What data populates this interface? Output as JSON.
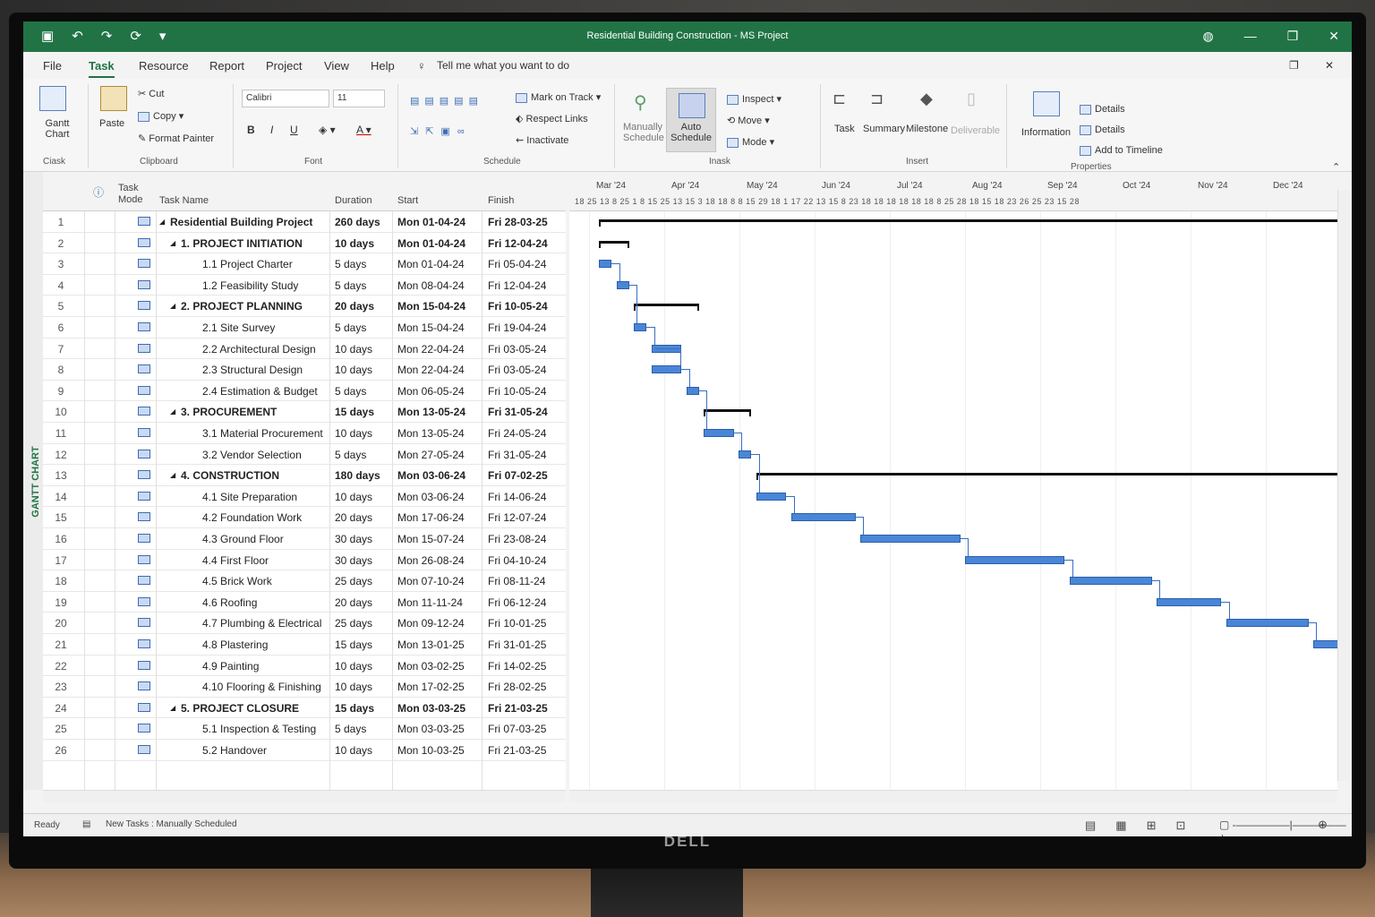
{
  "window": {
    "title": "Residential Building Construction  -  MS Project"
  },
  "menu": [
    "File",
    "Task",
    "Resource",
    "Report",
    "Project",
    "View",
    "Help"
  ],
  "menu_active": "Task",
  "tell_me": "Tell me what you want to do",
  "ribbon": {
    "gantt_chart": "Gantt Chart",
    "paste": "Paste",
    "cut": "Cut",
    "copy": "Copy",
    "format_painter": "Format Painter",
    "font_name": "Calibri",
    "font_size": "11",
    "mark_on_track": "Mark on Track",
    "respect_links": "Respect Links",
    "inactivate": "Inactivate",
    "manually_schedule": "Manually Schedule",
    "auto_schedule": "Auto Schedule",
    "inspect": "Inspect",
    "move": "Move",
    "mode": "Mode",
    "task": "Task",
    "summary": "Summary",
    "milestone": "Milestone",
    "deliverable": "Deliverable",
    "information": "Information",
    "details1": "Details",
    "details2": "Details",
    "add_to_timeline": "Add to Timeline",
    "groups": {
      "view": "Ciask",
      "clipboard": "Clipboard",
      "font": "Font",
      "schedule": "Schedule",
      "tasks": "Inask",
      "insert": "Insert",
      "properties": "Properties"
    }
  },
  "side_label": "GANTT CHART",
  "columns": {
    "mode": "Task Mode",
    "name": "Task Name",
    "duration": "Duration",
    "start": "Start",
    "finish": "Finish"
  },
  "tasks": [
    {
      "id": "1",
      "name": "Residential Building Project",
      "duration": "260 days",
      "start": "Mon 01-04-24",
      "finish": "Fri 28-03-25",
      "level": 0,
      "summary": true
    },
    {
      "id": "2",
      "name": "1. PROJECT INITIATION",
      "duration": "10 days",
      "start": "Mon 01-04-24",
      "finish": "Fri 12-04-24",
      "level": 1,
      "summary": true
    },
    {
      "id": "3",
      "name": "1.1 Project Charter",
      "duration": "5 days",
      "start": "Mon 01-04-24",
      "finish": "Fri 05-04-24",
      "level": 2,
      "summary": false
    },
    {
      "id": "4",
      "name": "1.2 Feasibility Study",
      "duration": "5 days",
      "start": "Mon 08-04-24",
      "finish": "Fri 12-04-24",
      "level": 2,
      "summary": false
    },
    {
      "id": "5",
      "name": "2. PROJECT PLANNING",
      "duration": "20 days",
      "start": "Mon 15-04-24",
      "finish": "Fri 10-05-24",
      "level": 1,
      "summary": true
    },
    {
      "id": "6",
      "name": "2.1 Site Survey",
      "duration": "5 days",
      "start": "Mon 15-04-24",
      "finish": "Fri 19-04-24",
      "level": 2,
      "summary": false
    },
    {
      "id": "7",
      "name": "2.2 Architectural Design",
      "duration": "10 days",
      "start": "Mon 22-04-24",
      "finish": "Fri 03-05-24",
      "level": 2,
      "summary": false
    },
    {
      "id": "8",
      "name": "2.3 Structural Design",
      "duration": "10 days",
      "start": "Mon 22-04-24",
      "finish": "Fri 03-05-24",
      "level": 2,
      "summary": false
    },
    {
      "id": "9",
      "name": "2.4 Estimation & Budget",
      "duration": "5 days",
      "start": "Mon 06-05-24",
      "finish": "Fri 10-05-24",
      "level": 2,
      "summary": false
    },
    {
      "id": "10",
      "name": "3. PROCUREMENT",
      "duration": "15 days",
      "start": "Mon 13-05-24",
      "finish": "Fri 31-05-24",
      "level": 1,
      "summary": true
    },
    {
      "id": "11",
      "name": "3.1 Material Procurement",
      "duration": "10 days",
      "start": "Mon 13-05-24",
      "finish": "Fri 24-05-24",
      "level": 2,
      "summary": false
    },
    {
      "id": "12",
      "name": "3.2 Vendor Selection",
      "duration": "5 days",
      "start": "Mon 27-05-24",
      "finish": "Fri 31-05-24",
      "level": 2,
      "summary": false
    },
    {
      "id": "13",
      "name": "4. CONSTRUCTION",
      "duration": "180 days",
      "start": "Mon 03-06-24",
      "finish": "Fri 07-02-25",
      "level": 1,
      "summary": true
    },
    {
      "id": "14",
      "name": "4.1 Site Preparation",
      "duration": "10 days",
      "start": "Mon 03-06-24",
      "finish": "Fri 14-06-24",
      "level": 2,
      "summary": false
    },
    {
      "id": "15",
      "name": "4.2 Foundation Work",
      "duration": "20 days",
      "start": "Mon 17-06-24",
      "finish": "Fri 12-07-24",
      "level": 2,
      "summary": false
    },
    {
      "id": "16",
      "name": "4.3 Ground Floor",
      "duration": "30 days",
      "start": "Mon 15-07-24",
      "finish": "Fri 23-08-24",
      "level": 2,
      "summary": false
    },
    {
      "id": "17",
      "name": "4.4 First Floor",
      "duration": "30 days",
      "start": "Mon 26-08-24",
      "finish": "Fri 04-10-24",
      "level": 2,
      "summary": false
    },
    {
      "id": "18",
      "name": "4.5 Brick Work",
      "duration": "25 days",
      "start": "Mon 07-10-24",
      "finish": "Fri 08-11-24",
      "level": 2,
      "summary": false
    },
    {
      "id": "19",
      "name": "4.6 Roofing",
      "duration": "20 days",
      "start": "Mon 11-11-24",
      "finish": "Fri 06-12-24",
      "level": 2,
      "summary": false
    },
    {
      "id": "20",
      "name": "4.7 Plumbing & Electrical",
      "duration": "25 days",
      "start": "Mon 09-12-24",
      "finish": "Fri 10-01-25",
      "level": 2,
      "summary": false
    },
    {
      "id": "21",
      "name": "4.8 Plastering",
      "duration": "15 days",
      "start": "Mon 13-01-25",
      "finish": "Fri 31-01-25",
      "level": 2,
      "summary": false
    },
    {
      "id": "22",
      "name": "4.9 Painting",
      "duration": "10 days",
      "start": "Mon 03-02-25",
      "finish": "Fri 14-02-25",
      "level": 2,
      "summary": false
    },
    {
      "id": "23",
      "name": "4.10 Flooring & Finishing",
      "duration": "10 days",
      "start": "Mon 17-02-25",
      "finish": "Fri 28-02-25",
      "level": 2,
      "summary": false
    },
    {
      "id": "24",
      "name": "5. PROJECT CLOSURE",
      "duration": "15 days",
      "start": "Mon 03-03-25",
      "finish": "Fri 21-03-25",
      "level": 1,
      "summary": true
    },
    {
      "id": "25",
      "name": "5.1 Inspection & Testing",
      "duration": "5 days",
      "start": "Mon 03-03-25",
      "finish": "Fri 07-03-25",
      "level": 2,
      "summary": false
    },
    {
      "id": "26",
      "name": "5.2 Handover",
      "duration": "10 days",
      "start": "Mon 10-03-25",
      "finish": "Fri 21-03-25",
      "level": 2,
      "summary": false
    }
  ],
  "timescale": {
    "months": [
      "Mar '24",
      "Apr '24",
      "May '24",
      "Jun '24",
      "Jul '24",
      "Aug '24",
      "Sep '24",
      "Oct '24",
      "Nov '24",
      "Dec '24"
    ],
    "days": "18  25  13  8  25  1  8 15  25  13  15  3  18  18  8  8  15  29  18  1  17  22  13  15  8  23  18  18  18  18  18  18  8  25  28  18  15  18  23  26  25  23  15  28"
  },
  "status": {
    "ready": "Ready",
    "new_tasks": "New Tasks : Manually Scheduled"
  },
  "brand": "DELL"
}
